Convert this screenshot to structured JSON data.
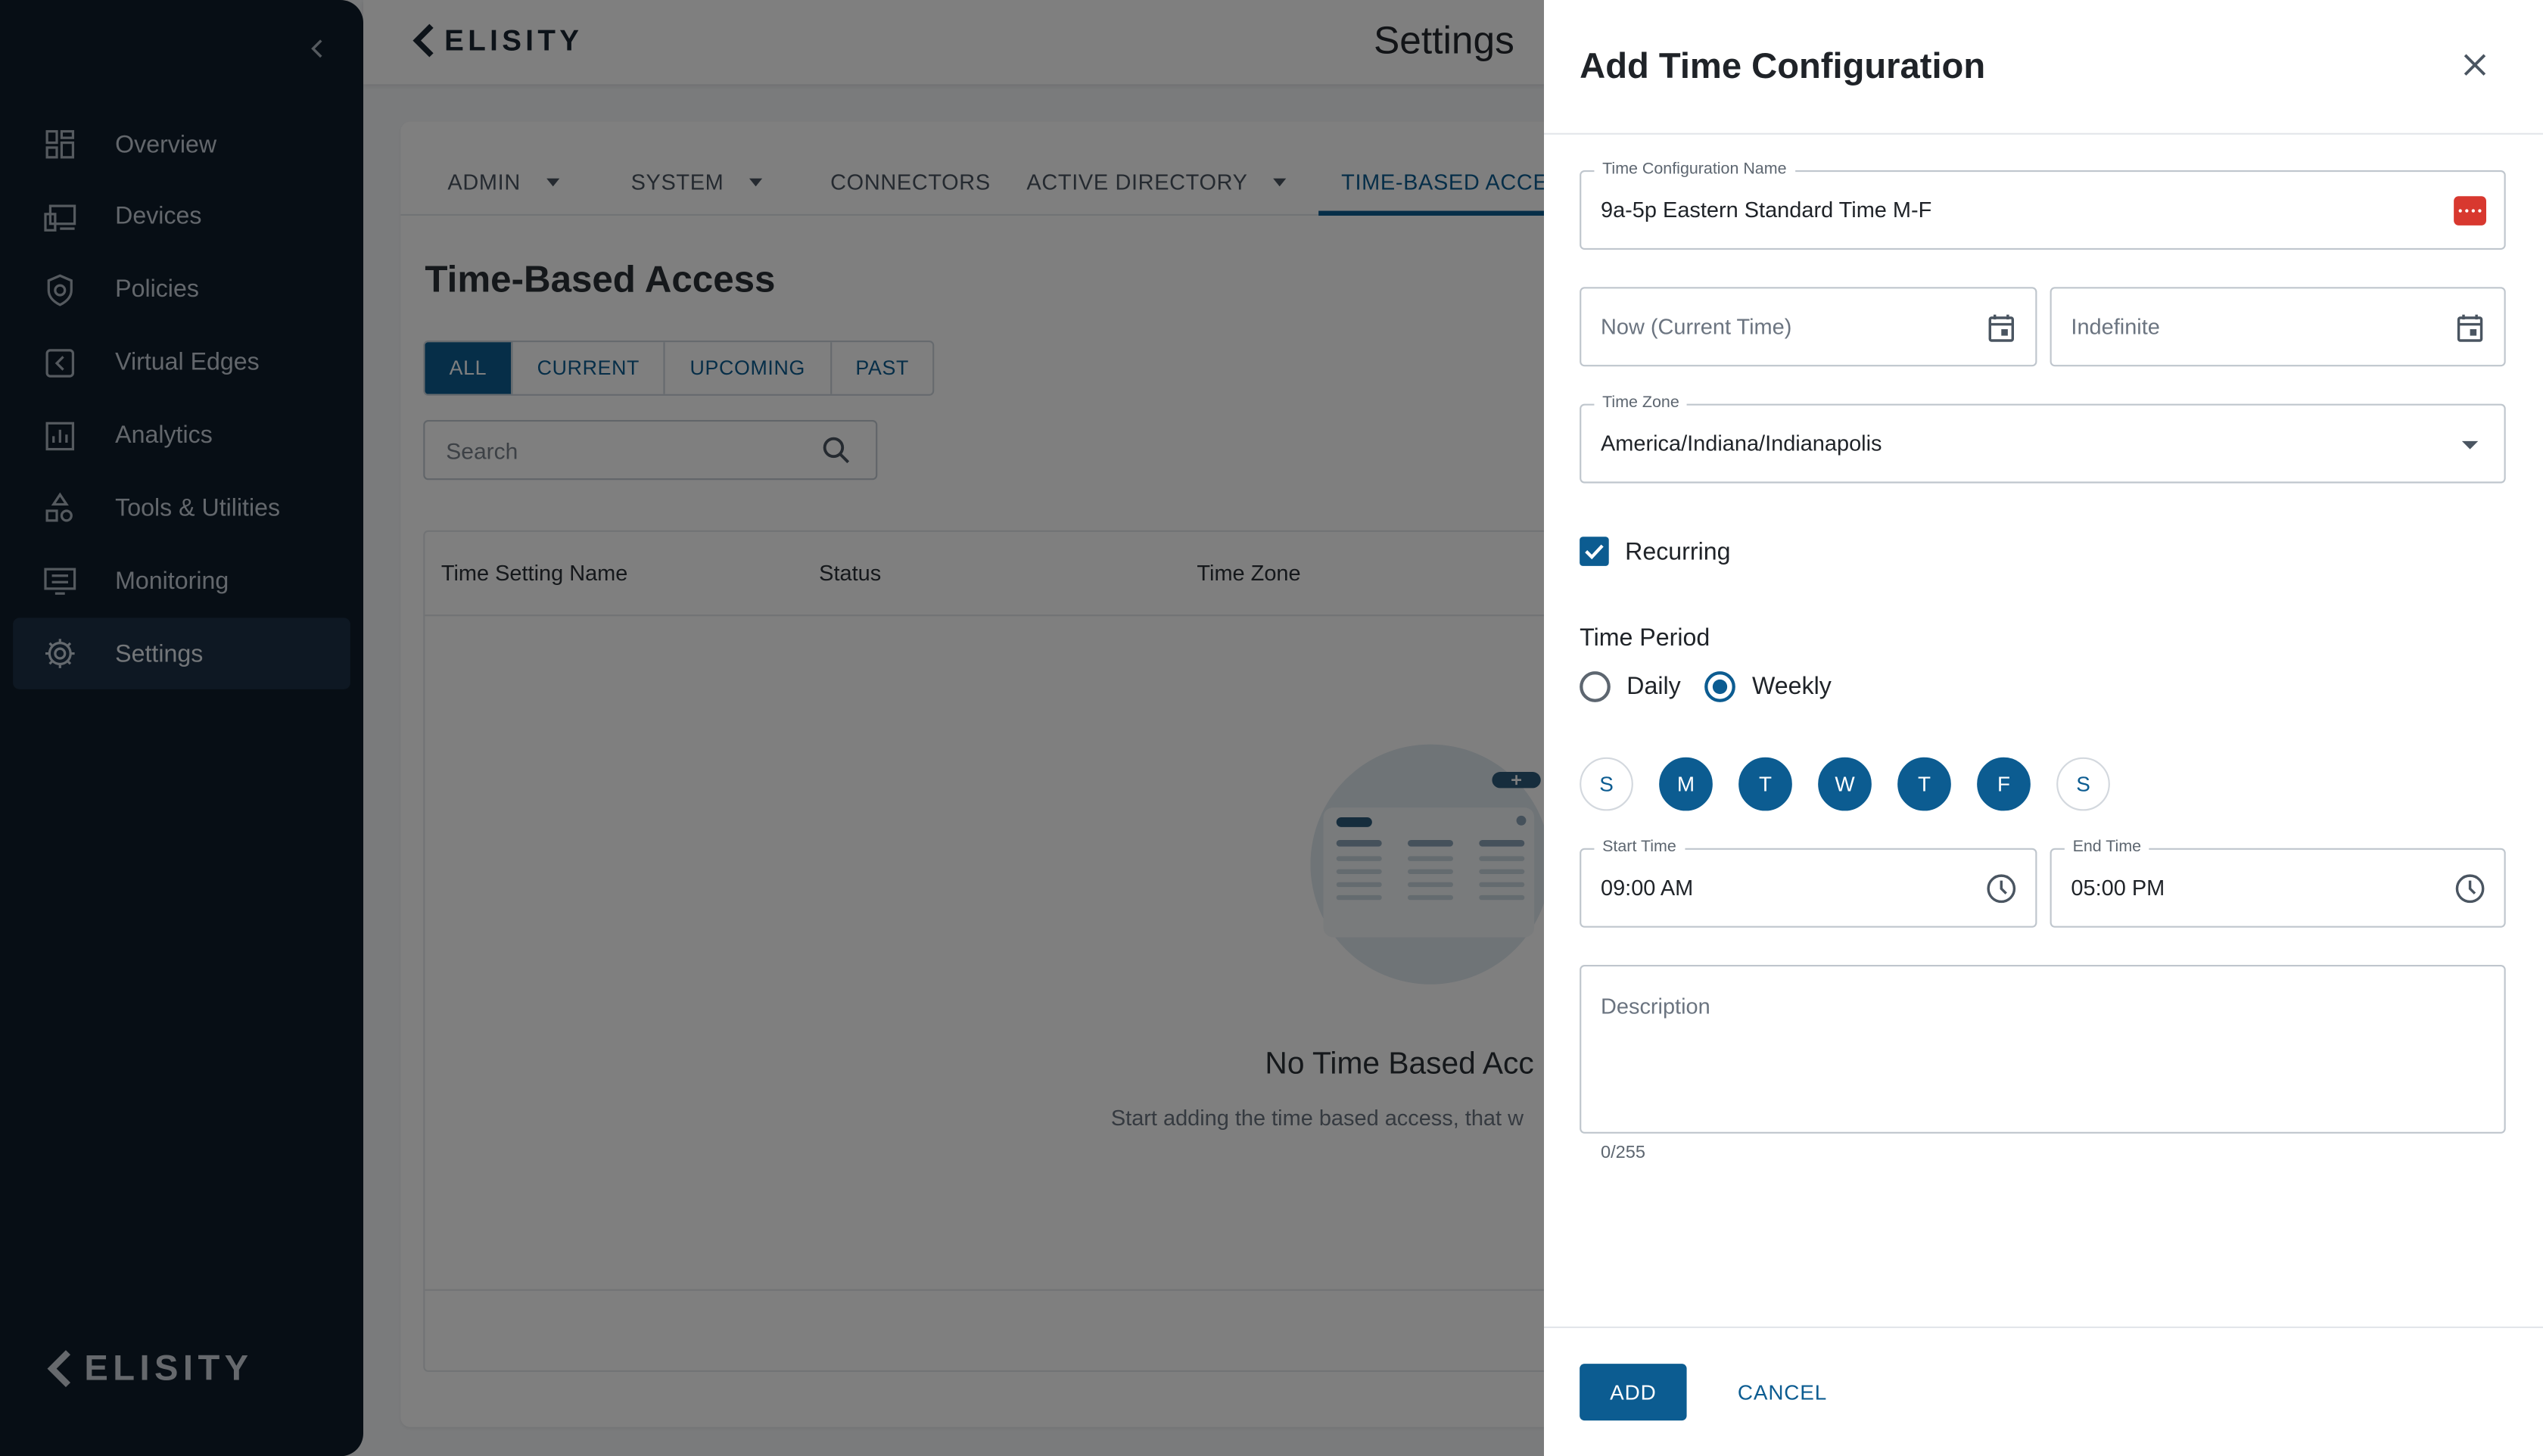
{
  "header": {
    "brand": "ELISITY",
    "title": "Settings"
  },
  "sidebar": {
    "items": [
      {
        "label": "Overview",
        "icon": "grid-icon"
      },
      {
        "label": "Devices",
        "icon": "devices-icon"
      },
      {
        "label": "Policies",
        "icon": "shield-icon"
      },
      {
        "label": "Virtual Edges",
        "icon": "virtual-edge-icon"
      },
      {
        "label": "Analytics",
        "icon": "bar-chart-icon"
      },
      {
        "label": "Tools & Utilities",
        "icon": "tools-icon"
      },
      {
        "label": "Monitoring",
        "icon": "monitor-icon"
      },
      {
        "label": "Settings",
        "icon": "gear-icon"
      }
    ],
    "active": "Settings",
    "footer_logo": "ELISITY"
  },
  "main": {
    "tabs": [
      {
        "label": "ADMIN",
        "has_menu": true
      },
      {
        "label": "SYSTEM",
        "has_menu": true
      },
      {
        "label": "CONNECTORS",
        "has_menu": false
      },
      {
        "label": "ACTIVE DIRECTORY",
        "has_menu": true
      },
      {
        "label": "TIME-BASED ACCES",
        "has_menu": false
      }
    ],
    "active_tab": "TIME-BASED ACCES",
    "section_title": "Time-Based Access",
    "filters": [
      "ALL",
      "CURRENT",
      "UPCOMING",
      "PAST"
    ],
    "active_filter": "ALL",
    "search_placeholder": "Search",
    "columns": [
      "Time Setting Name",
      "Status",
      "Time Zone"
    ],
    "empty_title": "No Time Based Acc",
    "empty_subtitle": "Start adding the time based access, that w"
  },
  "drawer": {
    "title": "Add Time Configuration",
    "name_label": "Time Configuration Name",
    "name_value": "9a-5p Eastern Standard Time M-F",
    "start_date_placeholder": "Now (Current Time)",
    "end_date_placeholder": "Indefinite",
    "timezone_label": "Time Zone",
    "timezone_value": "America/Indiana/Indianapolis",
    "recurring_label": "Recurring",
    "recurring_checked": true,
    "time_period_label": "Time Period",
    "period_options": [
      "Daily",
      "Weekly"
    ],
    "period_selected": "Weekly",
    "days": [
      {
        "label": "S",
        "selected": false
      },
      {
        "label": "M",
        "selected": true
      },
      {
        "label": "T",
        "selected": true
      },
      {
        "label": "W",
        "selected": true
      },
      {
        "label": "T",
        "selected": true
      },
      {
        "label": "F",
        "selected": true
      },
      {
        "label": "S",
        "selected": false
      }
    ],
    "start_time_label": "Start Time",
    "start_time_value": "09:00 AM",
    "end_time_label": "End Time",
    "end_time_value": "05:00 PM",
    "description_placeholder": "Description",
    "description_counter": "0/255",
    "add_label": "ADD",
    "cancel_label": "CANCEL"
  },
  "colors": {
    "accent": "#0c5c91",
    "sidebar_bg": "#0f1d2b",
    "password_badge": "#d8382f"
  }
}
